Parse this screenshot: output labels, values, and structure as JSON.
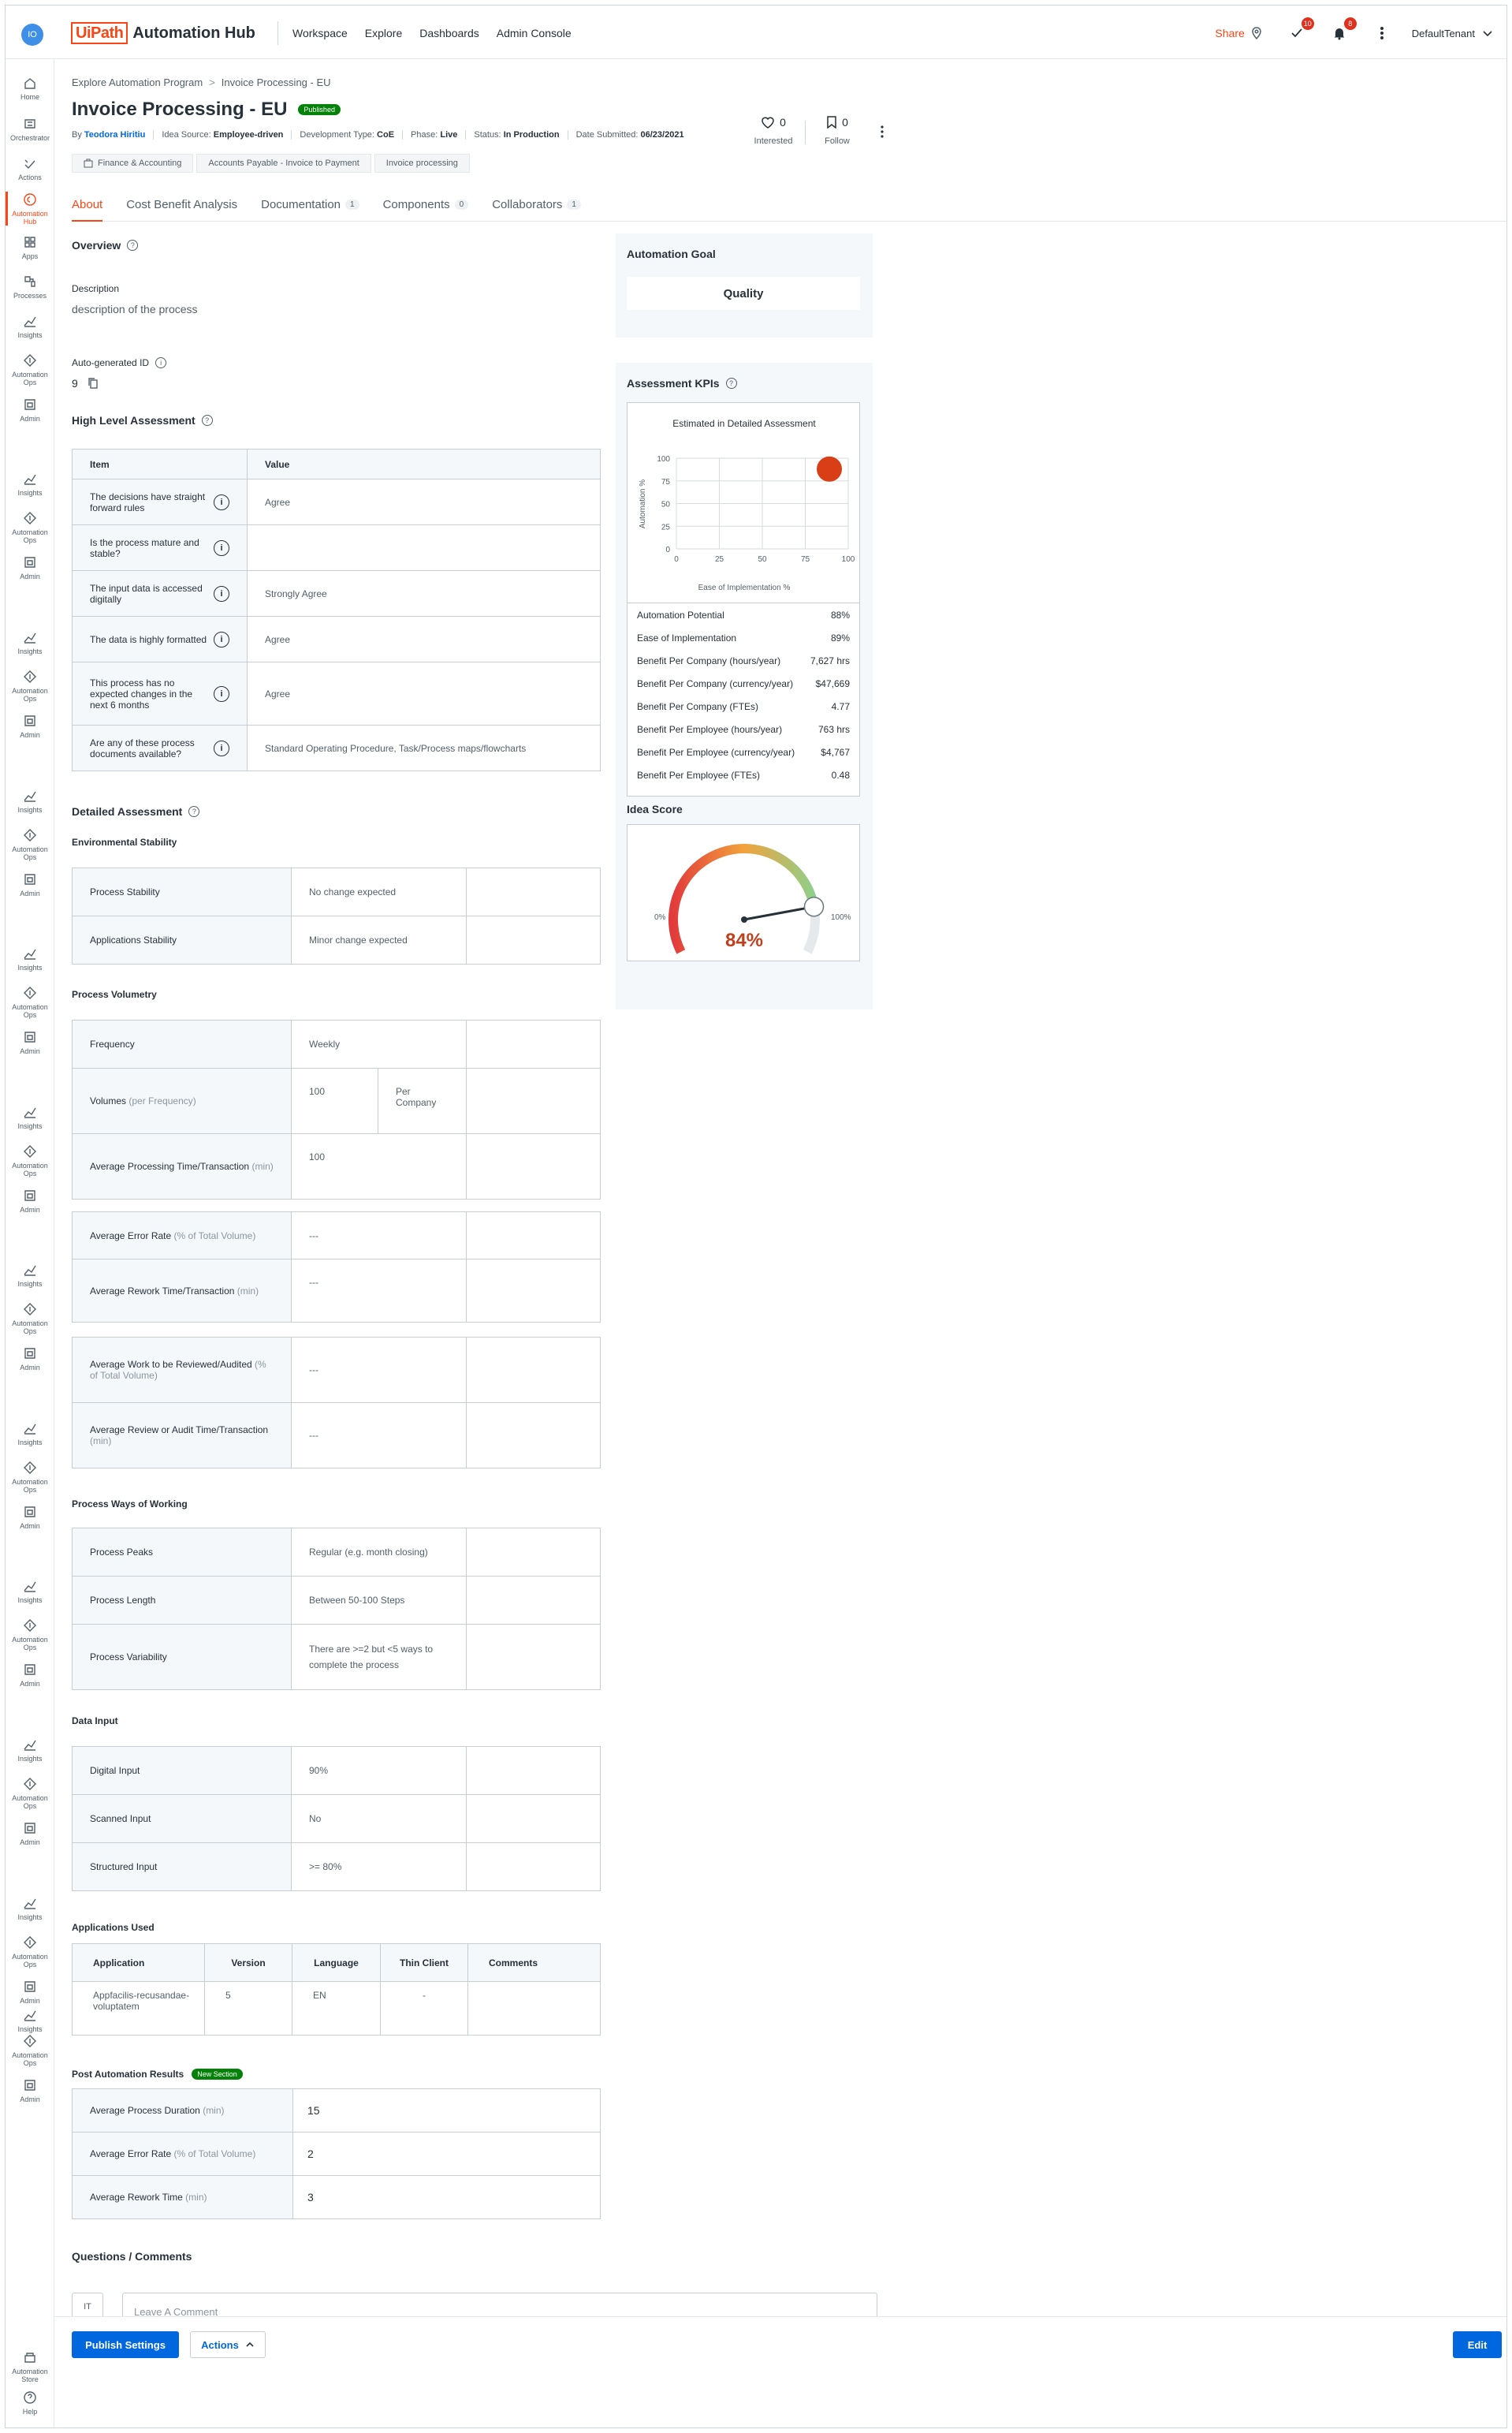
{
  "header": {
    "avatar_initials": "IO",
    "logo_mark": "UiPath",
    "logo_text": "Automation Hub",
    "nav": [
      "Workspace",
      "Explore",
      "Dashboards",
      "Admin Console"
    ],
    "share_label": "Share",
    "tasks_badge": "10",
    "notifications_badge": "8",
    "tenant": "DefaultTenant"
  },
  "rail": {
    "top": [
      {
        "label": "Home",
        "icon": "home-icon"
      },
      {
        "label": "Orchestrator",
        "icon": "orchestrator-icon"
      },
      {
        "label": "Actions",
        "icon": "actions-icon"
      },
      {
        "label": "Automation Hub",
        "icon": "automation-hub-icon"
      },
      {
        "label": "Apps",
        "icon": "apps-icon"
      },
      {
        "label": "Processes",
        "icon": "processes-icon"
      },
      {
        "label": "Insights",
        "icon": "insights-icon"
      },
      {
        "label": "Automation Ops",
        "icon": "automation-ops-icon"
      },
      {
        "label": "Admin",
        "icon": "admin-icon"
      }
    ],
    "repeat_labels": {
      "insights": "Insights",
      "ops": "Automation Ops",
      "admin": "Admin"
    },
    "bottom": [
      {
        "label": "Automation Store",
        "icon": "store-icon"
      },
      {
        "label": "Help",
        "icon": "help-icon"
      }
    ]
  },
  "breadcrumb": [
    "Explore Automation Program",
    "Invoice Processing - EU"
  ],
  "title": "Invoice Processing - EU",
  "status_pill": "Published",
  "meta": {
    "by_label": "By",
    "author": "Teodora Hiritiu",
    "idea_source_label": "Idea Source:",
    "idea_source": "Employee-driven",
    "dev_type_label": "Development Type:",
    "dev_type": "CoE",
    "phase_label": "Phase:",
    "phase": "Live",
    "status_label": "Status:",
    "status": "In Production",
    "date_label": "Date Submitted:",
    "date": "06/23/2021"
  },
  "tags": [
    "Finance & Accounting",
    "Accounts Payable - Invoice to Payment",
    "Invoice processing"
  ],
  "stats": {
    "interested_count": "0",
    "interested_label": "Interested",
    "follow_count": "0",
    "follow_label": "Follow"
  },
  "tabs": [
    {
      "label": "About",
      "count": ""
    },
    {
      "label": "Cost Benefit Analysis",
      "count": ""
    },
    {
      "label": "Documentation",
      "count": "1"
    },
    {
      "label": "Components",
      "count": "0"
    },
    {
      "label": "Collaborators",
      "count": "1"
    }
  ],
  "overview": {
    "heading": "Overview",
    "description_label": "Description",
    "description": "description of the process",
    "id_label": "Auto-generated ID",
    "id_value": "9"
  },
  "hla": {
    "heading": "High Level Assessment",
    "col_item": "Item",
    "col_value": "Value",
    "rows": [
      {
        "item": "The decisions have straight forward rules",
        "value": "Agree"
      },
      {
        "item": "Is the process mature and stable?",
        "value": ""
      },
      {
        "item": "The input data is accessed digitally",
        "value": "Strongly Agree"
      },
      {
        "item": "The data is highly formatted",
        "value": "Agree"
      },
      {
        "item": "This process has no expected changes in the next 6 months",
        "value": "Agree"
      },
      {
        "item": "Are any of these process documents available?",
        "value": "Standard Operating Procedure, Task/Process maps/flowcharts"
      }
    ]
  },
  "detailed": {
    "heading": "Detailed Assessment",
    "env": {
      "heading": "Environmental Stability",
      "rows": [
        {
          "k": "Process Stability",
          "v": "No change expected"
        },
        {
          "k": "Applications Stability",
          "v": "Minor change expected"
        }
      ]
    },
    "volumetry": {
      "heading": "Process Volumetry",
      "frequency_label": "Frequency",
      "frequency": "Weekly",
      "volumes_label": "Volumes",
      "volumes_muted": "(per Frequency)",
      "volumes_value": "100",
      "volumes_unit": "Per Company",
      "apt_label": "Average Processing Time/Transaction",
      "apt_muted": "(min)",
      "apt_value": "100",
      "aer_label": "Average Error Rate",
      "aer_muted": "(% of Total Volume)",
      "aer_value": "---",
      "art_label": "Average Rework Time/Transaction",
      "art_muted": "(min)",
      "art_value": "---",
      "awr_label": "Average Work to be Reviewed/Audited",
      "awr_muted": "(% of Total Volume)",
      "awr_value": "---",
      "ara_label": "Average Review or Audit Time/Transaction",
      "ara_muted": "(min)",
      "ara_value": "---"
    },
    "ways": {
      "heading": "Process Ways of Working",
      "rows": [
        {
          "k": "Process Peaks",
          "v": "Regular (e.g. month closing)"
        },
        {
          "k": "Process Length",
          "v": "Between 50-100 Steps"
        },
        {
          "k": "Process Variability",
          "v": "There are >=2 but <5 ways to complete the process"
        }
      ]
    },
    "data_input": {
      "heading": "Data Input",
      "rows": [
        {
          "k": "Digital Input",
          "v": "90%"
        },
        {
          "k": "Scanned Input",
          "v": "No"
        },
        {
          "k": "Structured Input",
          "v": ">= 80%"
        }
      ]
    },
    "apps": {
      "heading": "Applications Used",
      "cols": [
        "Application",
        "Version",
        "Language",
        "Thin Client",
        "Comments"
      ],
      "rows": [
        {
          "application": "Appfacilis-recusandae-voluptatem",
          "version": "5",
          "language": "EN",
          "thin": "-",
          "comments": ""
        }
      ]
    },
    "post": {
      "heading": "Post Automation Results",
      "badge": "New Section",
      "rows": [
        {
          "k": "Average Process Duration",
          "m": "(min)",
          "v": "15"
        },
        {
          "k": "Average Error Rate",
          "m": "(% of Total Volume)",
          "v": "2"
        },
        {
          "k": "Average Rework Time",
          "m": "(min)",
          "v": "3"
        }
      ]
    }
  },
  "goal": {
    "heading": "Automation Goal",
    "value": "Quality"
  },
  "kpis": {
    "heading": "Assessment KPIs",
    "chart_title": "Estimated in Detailed Assessment",
    "y_label": "Automation %",
    "x_label": "Ease of Implementation %",
    "ticks": [
      "0",
      "25",
      "50",
      "75",
      "100"
    ],
    "point": {
      "ease": 89,
      "automation": 88
    },
    "point_color": "#d93f16",
    "rows": [
      {
        "k": "Automation Potential",
        "v": "88%"
      },
      {
        "k": "Ease of Implementation",
        "v": "89%"
      },
      {
        "k": "Benefit Per Company (hours/year)",
        "v": "7,627 hrs"
      },
      {
        "k": "Benefit Per Company (currency/year)",
        "v": "$47,669"
      },
      {
        "k": "Benefit Per Company (FTEs)",
        "v": "4.77"
      },
      {
        "k": "Benefit Per Employee (hours/year)",
        "v": "763 hrs"
      },
      {
        "k": "Benefit Per Employee (currency/year)",
        "v": "$4,767"
      },
      {
        "k": "Benefit Per Employee (FTEs)",
        "v": "0.48"
      }
    ]
  },
  "idea_score": {
    "heading": "Idea Score",
    "value": "84%",
    "percent": 84,
    "min_label": "0%",
    "max_label": "100%"
  },
  "comments": {
    "heading": "Questions / Comments",
    "avatar": "IT",
    "placeholder": "Leave A Comment"
  },
  "footer": {
    "publish": "Publish Settings",
    "actions": "Actions",
    "edit": "Edit"
  }
}
